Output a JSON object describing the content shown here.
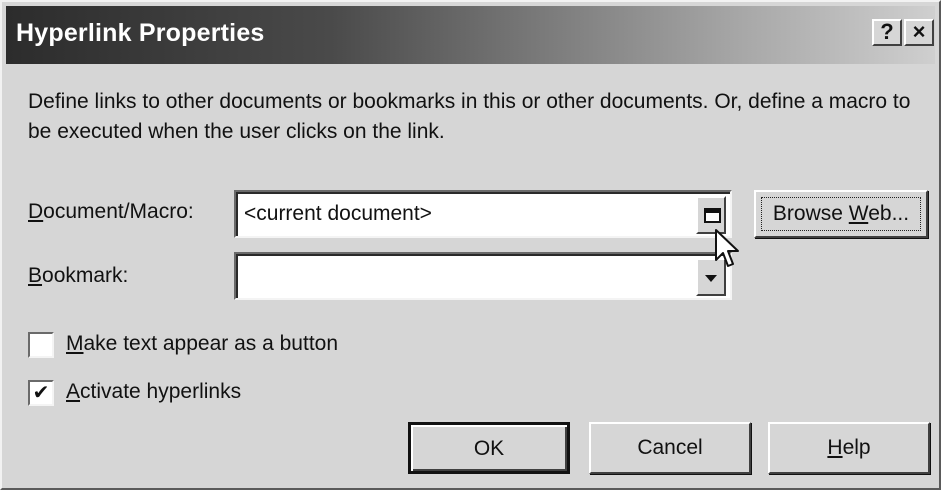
{
  "window": {
    "title": "Hyperlink Properties",
    "help_button": "?",
    "close_button": "×"
  },
  "description": "Define links to other documents or bookmarks in this or other documents. Or, define a macro to be executed when the user clicks on the link.",
  "document_macro": {
    "label_mnemonic": "D",
    "label_rest": "ocument/Macro:",
    "value": "<current document>",
    "button_icon": "document-picker-icon"
  },
  "browse_web": {
    "label_before": "Browse ",
    "label_mnemonic": "W",
    "label_after": "eb..."
  },
  "bookmark": {
    "label_mnemonic": "B",
    "label_rest": "ookmark:",
    "value": "",
    "button_icon": "chevron-down-icon"
  },
  "options": [
    {
      "mnemonic": "M",
      "rest": "ake text appear as a button",
      "checked": false,
      "mark": ""
    },
    {
      "mnemonic": "A",
      "rest": "ctivate hyperlinks",
      "checked": true,
      "mark": "✔"
    }
  ],
  "buttons": {
    "ok": "OK",
    "cancel": "Cancel",
    "help_mnemonic": "H",
    "help_rest": "elp"
  },
  "colors": {
    "title_gradient_start": "#2c2c2c",
    "title_gradient_end": "#cfcfcf",
    "face": "#d6d6d6"
  }
}
